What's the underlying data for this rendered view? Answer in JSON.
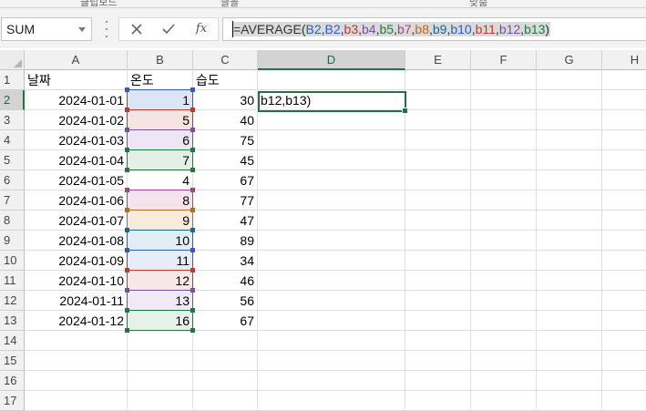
{
  "ribbon_partial": [
    "클립보드",
    "글꼴",
    "맞춤"
  ],
  "name_box": {
    "value": "SUM"
  },
  "formula_buttons": {
    "cancel_icon": "close-icon",
    "enter_icon": "check-icon",
    "fx_label": "fx"
  },
  "formula_bar": {
    "prefix": "=AVERAGE(",
    "refs": [
      {
        "text": "B2",
        "color": "#2f5fb3"
      },
      {
        "text": "B2",
        "color": "#2f5fb3"
      },
      {
        "text": "b3",
        "color": "#c0392b"
      },
      {
        "text": "b4",
        "color": "#7b4ea3"
      },
      {
        "text": "b5",
        "color": "#1e7b3e"
      },
      {
        "text": "b7",
        "color": "#a53f8f"
      },
      {
        "text": "b8",
        "color": "#b86a16"
      },
      {
        "text": "b9",
        "color": "#1f6690"
      },
      {
        "text": "b10",
        "color": "#2f5fb3"
      },
      {
        "text": "b11",
        "color": "#c0392b"
      },
      {
        "text": "b12",
        "color": "#7b4ea3"
      },
      {
        "text": "b13",
        "color": "#1e7b3e"
      }
    ],
    "suffix": ")"
  },
  "columns": [
    "A",
    "B",
    "C",
    "D",
    "E",
    "F",
    "G",
    "H"
  ],
  "active_column": "D",
  "rows": [
    "1",
    "2",
    "3",
    "4",
    "5",
    "6",
    "7",
    "8",
    "9",
    "10",
    "11",
    "12",
    "13",
    "14",
    "15",
    "16",
    "17"
  ],
  "active_row": "2",
  "headers": {
    "a": "날짜",
    "b": "온도",
    "c": "습도"
  },
  "data_rows": [
    {
      "date": "2024-01-01",
      "temp": "1",
      "hum": "30"
    },
    {
      "date": "2024-01-02",
      "temp": "5",
      "hum": "40"
    },
    {
      "date": "2024-01-03",
      "temp": "6",
      "hum": "75"
    },
    {
      "date": "2024-01-04",
      "temp": "7",
      "hum": "45"
    },
    {
      "date": "2024-01-05",
      "temp": "4",
      "hum": "67"
    },
    {
      "date": "2024-01-06",
      "temp": "8",
      "hum": "77"
    },
    {
      "date": "2024-01-07",
      "temp": "9",
      "hum": "47"
    },
    {
      "date": "2024-01-08",
      "temp": "10",
      "hum": "89"
    },
    {
      "date": "2024-01-09",
      "temp": "11",
      "hum": "34"
    },
    {
      "date": "2024-01-10",
      "temp": "12",
      "hum": "46"
    },
    {
      "date": "2024-01-11",
      "temp": "13",
      "hum": "56"
    },
    {
      "date": "2024-01-12",
      "temp": "16",
      "hum": "67"
    }
  ],
  "active_cell_text": "b12,b13)",
  "ref_highlights": [
    {
      "row": 2,
      "color": "#2f5fb3",
      "fill": "#dbe5f6"
    },
    {
      "row": 3,
      "color": "#c0392b",
      "fill": "#f8e3e3"
    },
    {
      "row": 4,
      "color": "#7b4ea3",
      "fill": "#efe6f5"
    },
    {
      "row": 5,
      "color": "#1e7b3e",
      "fill": "#e2f0e6"
    },
    {
      "row": 7,
      "color": "#a53f8f",
      "fill": "#f5e3f0"
    },
    {
      "row": 8,
      "color": "#b86a16",
      "fill": "#f9ebdc"
    },
    {
      "row": 9,
      "color": "#1f6690",
      "fill": "#e1ecf4"
    },
    {
      "row": 10,
      "color": "#2f5fb3",
      "fill": "#e6edf8"
    },
    {
      "row": 11,
      "color": "#c0392b",
      "fill": "#f9e6e6"
    },
    {
      "row": 12,
      "color": "#7b4ea3",
      "fill": "#f1eaf6"
    },
    {
      "row": 13,
      "color": "#1e7b3e",
      "fill": "#e5f2e9"
    }
  ]
}
